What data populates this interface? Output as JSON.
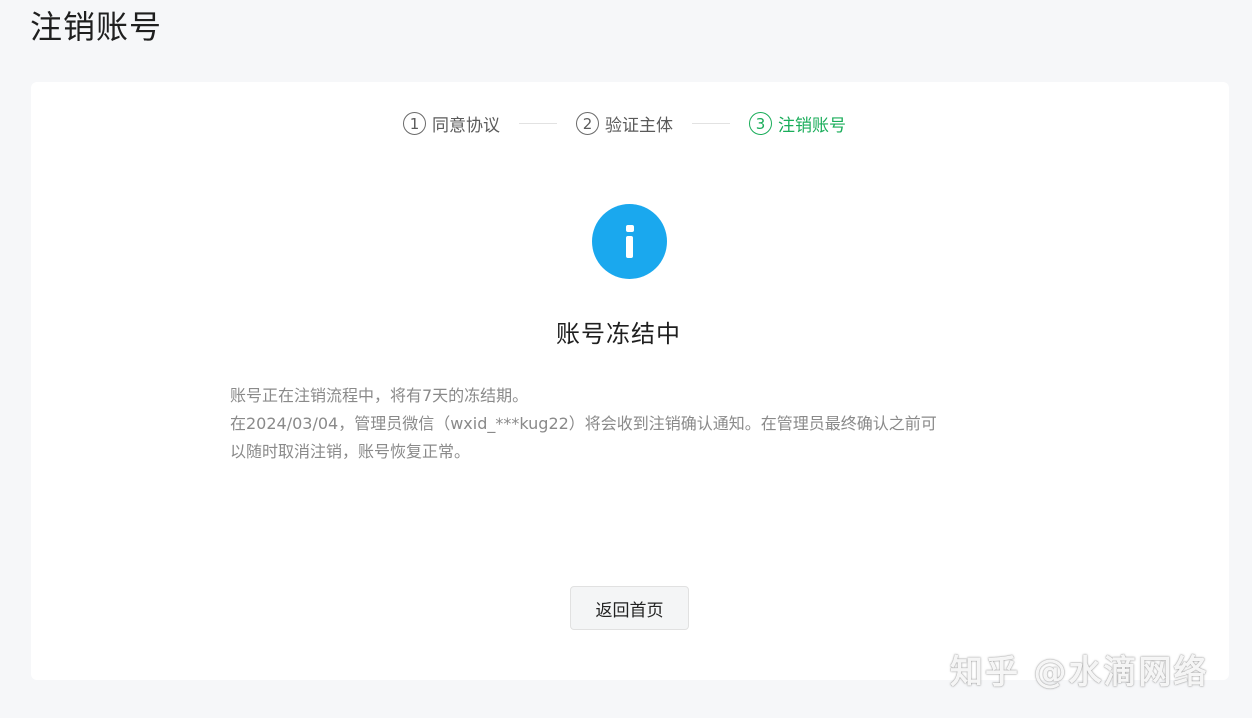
{
  "page": {
    "title": "注销账号"
  },
  "steps": [
    {
      "number": "1",
      "label": "同意协议",
      "state": "done"
    },
    {
      "number": "2",
      "label": "验证主体",
      "state": "done"
    },
    {
      "number": "3",
      "label": "注销账号",
      "state": "active"
    }
  ],
  "status": {
    "icon": "info-icon",
    "icon_color": "#1aa8ee",
    "title": "账号冻结中"
  },
  "description": {
    "line1": "账号正在注销流程中，将有7天的冻结期。",
    "line2": "在2024/03/04，管理员微信（wxid_***kug22）将会收到注销确认通知。在管理员最终确认之前可",
    "line3": "以随时取消注销，账号恢复正常。"
  },
  "actions": {
    "back_label": "返回首页"
  },
  "watermark": {
    "text": "知乎 @水滴网络"
  },
  "colors": {
    "accent_green": "#1aad5a",
    "info_blue": "#1aa8ee"
  }
}
